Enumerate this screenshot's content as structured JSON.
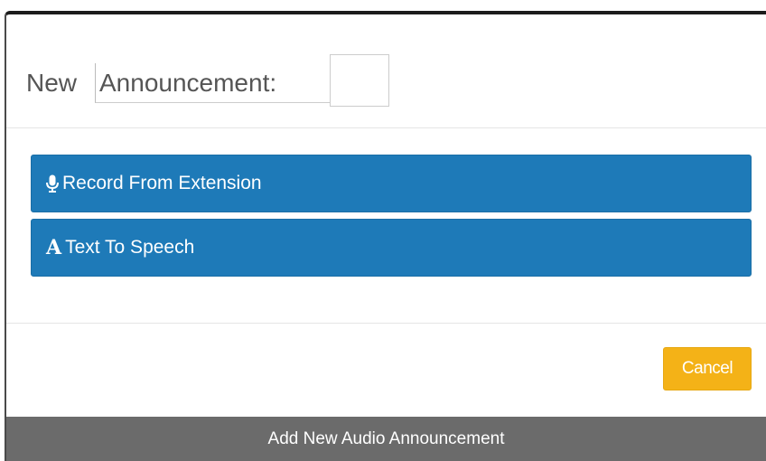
{
  "modal": {
    "title_prefix": "New",
    "title_input_value": "Announcement:",
    "title_input_placeholder": ""
  },
  "options": [
    {
      "label": "Record From Extension",
      "icon": "microphone-icon"
    },
    {
      "label": "Text To Speech",
      "icon": "font-icon",
      "icon_glyph": "A"
    }
  ],
  "footer": {
    "cancel_label": "Cancel"
  },
  "bottom_bar": {
    "label": "Add New Audio Announcement"
  },
  "colors": {
    "primary": "#1e7ab8",
    "warning": "#f4b217",
    "bar": "#6b6b6b"
  }
}
